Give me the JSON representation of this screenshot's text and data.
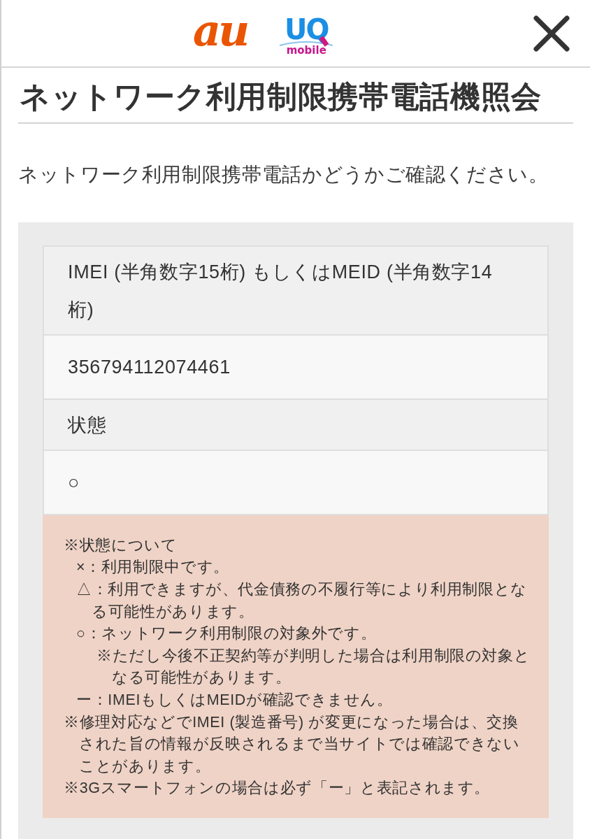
{
  "header": {
    "logos": [
      {
        "kind": "au",
        "text": "au"
      },
      {
        "kind": "uq",
        "text": "UQ",
        "subtext": "mobile"
      }
    ]
  },
  "page": {
    "title": "ネットワーク利用制限携帯電話機照会",
    "description": "ネットワーク利用制限携帯電話かどうかご確認ください。"
  },
  "result_table": {
    "rows": [
      {
        "label": "IMEI (半角数字15桁) もしくはMEID (半角数字14桁)",
        "value": "356794112074461"
      },
      {
        "label": "状態",
        "value": "○"
      }
    ]
  },
  "notes": {
    "heading": "※状態について",
    "statuses": [
      {
        "text": "×：利用制限中です。"
      },
      {
        "text": "△：利用できますが、代金債務の不履行等により利用制限となる可能性があります。"
      },
      {
        "text": "○：ネットワーク利用制限の対象外です。",
        "children": [
          {
            "text": "※ただし今後不正契約等が判明した場合は利用制限の対象となる可能性があります。"
          }
        ]
      },
      {
        "text": "ー：IMEIもしくはMEIDが確認できません。"
      }
    ],
    "remarks": [
      "※修理対応などでIMEI (製造番号) が変更になった場合は、交換された旨の情報が反映されるまで当サイトでは確認できないことがあります。",
      "※3Gスマートフォンの場合は必ず「ー」と表記されます。"
    ]
  }
}
